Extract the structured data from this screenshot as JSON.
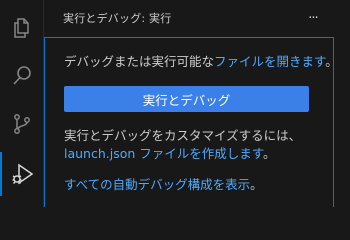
{
  "activity_bar": {
    "items": [
      {
        "icon": "files-icon"
      },
      {
        "icon": "search-icon"
      },
      {
        "icon": "source-control-icon"
      },
      {
        "icon": "run-debug-icon"
      }
    ]
  },
  "sidebar": {
    "title": "実行とデバッグ: 実行",
    "more_actions": "···",
    "welcome": {
      "line1_text": "デバッグまたは実行可能な",
      "line1_link": "ファイルを開きます",
      "line1_end": "。",
      "button_label": "実行とデバッグ",
      "line2_text": "実行とデバッグをカスタマイズするには、",
      "line3_link": "launch.json ファイルを作成します",
      "line3_end": "。",
      "line4_link": "すべての自動デバッグ構成を表示",
      "line4_end": "。"
    }
  },
  "colors": {
    "background": "#181818",
    "accent": "#0078d4",
    "button": "#3b80e8",
    "link": "#4daafc",
    "text": "#cccccc"
  }
}
